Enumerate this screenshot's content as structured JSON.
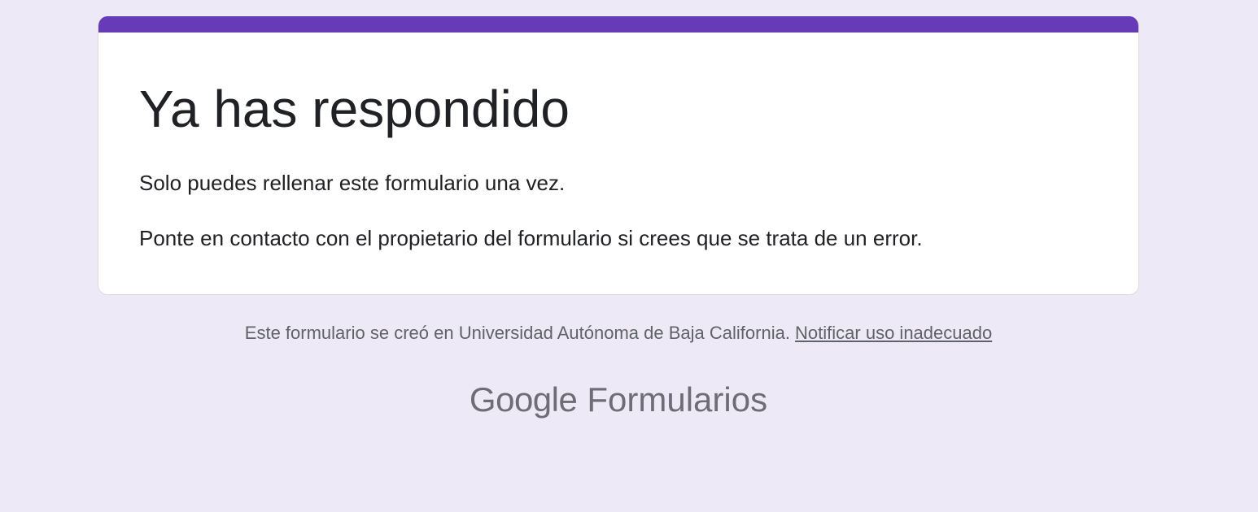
{
  "card": {
    "title": "Ya has respondido",
    "message_once": "Solo puedes rellenar este formulario una vez.",
    "message_contact": "Ponte en contacto con el propietario del formulario si crees que se trata de un error."
  },
  "footer": {
    "created_in_text": "Este formulario se creó en Universidad Autónoma de Baja California. ",
    "report_link": "Notificar uso inadecuado"
  },
  "brand": {
    "google": "Google",
    "product": "Formularios"
  },
  "colors": {
    "accent": "#673ab7",
    "background": "#ede9f7",
    "card": "#ffffff"
  }
}
